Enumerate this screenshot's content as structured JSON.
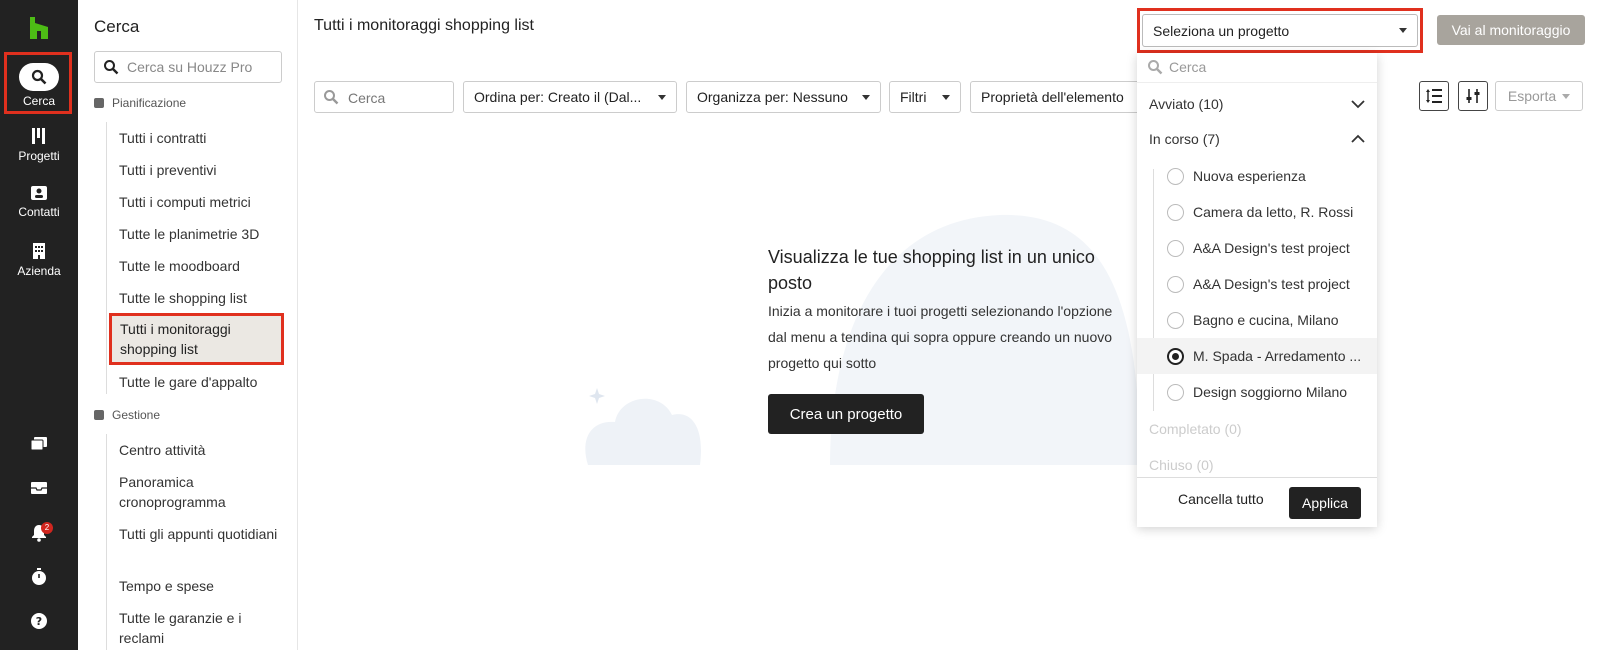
{
  "rail": {
    "items": [
      {
        "label": "Cerca",
        "icon": "search-icon"
      },
      {
        "label": "Progetti",
        "icon": "projects-icon"
      },
      {
        "label": "Contatti",
        "icon": "contacts-icon"
      },
      {
        "label": "Azienda",
        "icon": "building-icon"
      }
    ],
    "notifications_count": "2"
  },
  "sidebar": {
    "title": "Cerca",
    "search_placeholder": "Cerca su Houzz Pro",
    "section_planning": "Pianificazione",
    "planning_items": [
      "Tutti i contratti",
      "Tutti i preventivi",
      "Tutti i computi metrici",
      "Tutte le planimetrie 3D",
      "Tutte le moodboard",
      "Tutte le shopping list",
      "Tutti i monitoraggi shopping list",
      "Tutte le gare d'appalto"
    ],
    "section_management": "Gestione",
    "management_items": [
      "Centro attività",
      "Panoramica cronoprogramma",
      "Tutti gli appunti quotidiani",
      "Tempo e spese",
      "Tutte le garanzie e i reclami"
    ]
  },
  "main": {
    "title": "Tutti i monitoraggi shopping list",
    "search_placeholder": "Cerca",
    "sort_label": "Ordina per: Creato il (Dal...",
    "group_label": "Organizza per: Nessuno",
    "filters_label": "Filtri",
    "properties_label": "Proprietà dell'elemento",
    "export_label": "Esporta",
    "project_select_label": "Seleziona un progetto",
    "go_button_label": "Vai al monitoraggio"
  },
  "empty_state": {
    "title": "Visualizza le tue shopping list in un unico posto",
    "text": "Inizia a monitorare i tuoi progetti selezionando l'opzione dal menu a tendina qui sopra oppure creando un nuovo progetto qui sotto",
    "button_label": "Crea un progetto"
  },
  "dropdown": {
    "search_placeholder": "Cerca",
    "groups": {
      "started": "Avviato (10)",
      "in_progress": "In corso (7)",
      "completed": "Completato (0)",
      "closed": "Chiuso (0)"
    },
    "options": [
      "Nuova esperienza",
      "Camera da letto, R. Rossi",
      "A&A Design's test project",
      "A&A Design's test project",
      "Bagno e cucina, Milano",
      "M. Spada - Arredamento ...",
      "Design soggiorno Milano"
    ],
    "selected_index": 5,
    "clear_label": "Cancella tutto",
    "apply_label": "Applica"
  },
  "colors": {
    "rail_bg": "#222222",
    "brand_green": "#4dbc15",
    "highlight_red": "#e0301e",
    "primary_button": "#222222",
    "disabled_button": "#a8a49d"
  }
}
